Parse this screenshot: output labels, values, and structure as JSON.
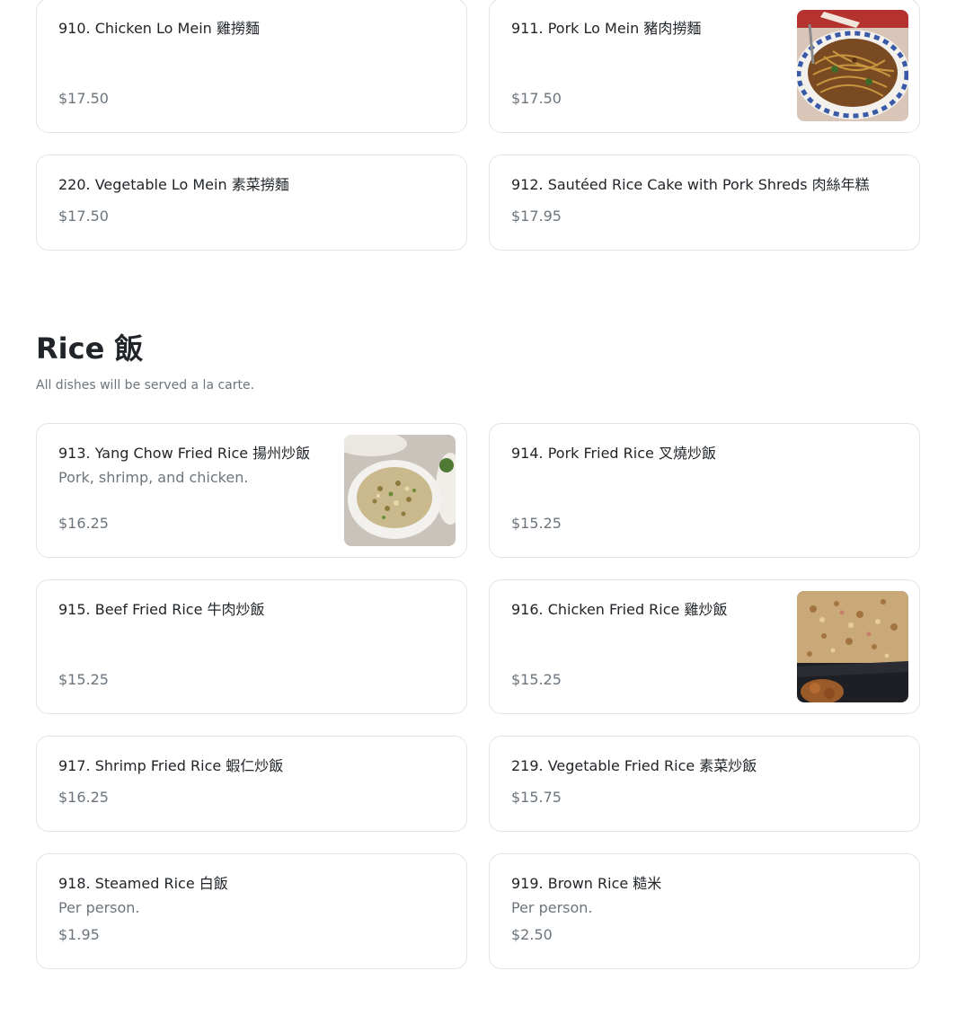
{
  "noodles": {
    "items": [
      {
        "name": "910. Chicken Lo Mein 雞撈麵",
        "price": "$17.50"
      },
      {
        "name": "911. Pork Lo Mein 豬肉撈麵",
        "price": "$17.50"
      },
      {
        "name": "220. Vegetable Lo Mein 素菜撈麵",
        "price": "$17.50"
      },
      {
        "name": "912. Sautéed Rice Cake with Pork Shreds 肉絲年糕",
        "price": "$17.95"
      }
    ]
  },
  "rice": {
    "title": "Rice 飯",
    "description": "All dishes will be served a la carte.",
    "items": [
      {
        "name": "913. Yang Chow Fried Rice 揚州炒飯",
        "description": "Pork, shrimp, and chicken.",
        "price": "$16.25"
      },
      {
        "name": "914. Pork Fried Rice 叉燒炒飯",
        "price": "$15.25"
      },
      {
        "name": "915. Beef Fried Rice 牛肉炒飯",
        "price": "$15.25"
      },
      {
        "name": "916. Chicken Fried Rice 雞炒飯",
        "price": "$15.25"
      },
      {
        "name": "917. Shrimp Fried Rice 蝦仁炒飯",
        "price": "$16.25"
      },
      {
        "name": "219. Vegetable Fried Rice 素菜炒飯",
        "price": "$15.75"
      },
      {
        "name": "918. Steamed Rice 白飯",
        "description": "Per person.",
        "price": "$1.95"
      },
      {
        "name": "919. Brown Rice 糙米",
        "description": "Per person.",
        "price": "$2.50"
      }
    ]
  }
}
